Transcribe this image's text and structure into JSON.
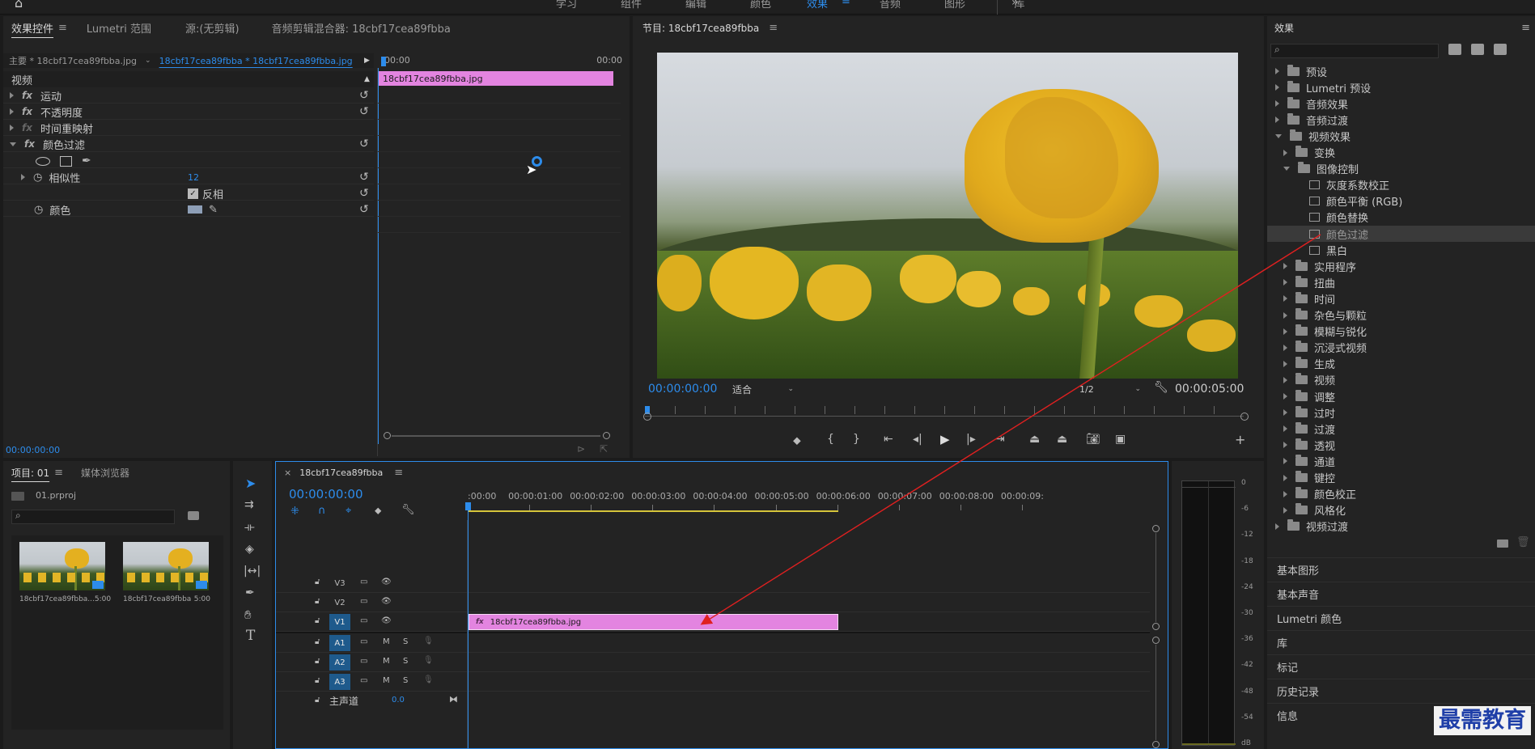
{
  "menu": {
    "items": [
      "学习",
      "组件",
      "编辑",
      "颜色",
      "效果",
      "音频",
      "图形",
      "库"
    ],
    "active": "效果",
    "overflow": "»"
  },
  "effect_controls": {
    "tabs": [
      "效果控件",
      "Lumetri 范围",
      "源:(无剪辑)",
      "音频剪辑混合器: 18cbf17cea89fbba"
    ],
    "master_label": "主要 * 18cbf17cea89fbba.jpg",
    "sequence_label": "18cbf17cea89fbba * 18cbf17cea89fbba.jpg",
    "time_start": "00:00",
    "time_end": "00:00",
    "section": "视频",
    "effects": [
      "运动",
      "不透明度",
      "时间重映射",
      "颜色过滤"
    ],
    "similarity_label": "相似性",
    "similarity_value": "12",
    "invert_label": "反相",
    "color_label": "颜色",
    "clip_label": "18cbf17cea89fbba.jpg",
    "timecode": "00:00:00:00"
  },
  "program_monitor": {
    "title": "节目: 18cbf17cea89fbba",
    "timecode": "00:00:00:00",
    "fit": "适合",
    "resolution": "1/2",
    "duration": "00:00:05:00"
  },
  "effects_panel": {
    "title": "效果",
    "tree": [
      {
        "label": "预设",
        "depth": 0,
        "icon": "folder-star",
        "state": "closed"
      },
      {
        "label": "Lumetri 预设",
        "depth": 0,
        "icon": "folder-star",
        "state": "closed"
      },
      {
        "label": "音频效果",
        "depth": 0,
        "icon": "folder",
        "state": "closed"
      },
      {
        "label": "音频过渡",
        "depth": 0,
        "icon": "folder",
        "state": "closed"
      },
      {
        "label": "视频效果",
        "depth": 0,
        "icon": "folder",
        "state": "open"
      },
      {
        "label": "变换",
        "depth": 1,
        "icon": "folder",
        "state": "closed"
      },
      {
        "label": "图像控制",
        "depth": 1,
        "icon": "folder",
        "state": "open"
      },
      {
        "label": "灰度系数校正",
        "depth": 2,
        "icon": "effect",
        "state": ""
      },
      {
        "label": "颜色平衡 (RGB)",
        "depth": 2,
        "icon": "effect",
        "state": ""
      },
      {
        "label": "颜色替换",
        "depth": 2,
        "icon": "effect",
        "state": ""
      },
      {
        "label": "颜色过滤",
        "depth": 2,
        "icon": "effect",
        "state": "selected"
      },
      {
        "label": "黑白",
        "depth": 2,
        "icon": "effect",
        "state": ""
      },
      {
        "label": "实用程序",
        "depth": 1,
        "icon": "folder",
        "state": "closed"
      },
      {
        "label": "扭曲",
        "depth": 1,
        "icon": "folder",
        "state": "closed"
      },
      {
        "label": "时间",
        "depth": 1,
        "icon": "folder",
        "state": "closed"
      },
      {
        "label": "杂色与颗粒",
        "depth": 1,
        "icon": "folder",
        "state": "closed"
      },
      {
        "label": "模糊与锐化",
        "depth": 1,
        "icon": "folder",
        "state": "closed"
      },
      {
        "label": "沉浸式视频",
        "depth": 1,
        "icon": "folder",
        "state": "closed"
      },
      {
        "label": "生成",
        "depth": 1,
        "icon": "folder",
        "state": "closed"
      },
      {
        "label": "视频",
        "depth": 1,
        "icon": "folder",
        "state": "closed"
      },
      {
        "label": "调整",
        "depth": 1,
        "icon": "folder",
        "state": "closed"
      },
      {
        "label": "过时",
        "depth": 1,
        "icon": "folder",
        "state": "closed"
      },
      {
        "label": "过渡",
        "depth": 1,
        "icon": "folder",
        "state": "closed"
      },
      {
        "label": "透视",
        "depth": 1,
        "icon": "folder",
        "state": "closed"
      },
      {
        "label": "通道",
        "depth": 1,
        "icon": "folder",
        "state": "closed"
      },
      {
        "label": "键控",
        "depth": 1,
        "icon": "folder",
        "state": "closed"
      },
      {
        "label": "颜色校正",
        "depth": 1,
        "icon": "folder",
        "state": "closed"
      },
      {
        "label": "风格化",
        "depth": 1,
        "icon": "folder",
        "state": "closed"
      },
      {
        "label": "视频过渡",
        "depth": 0,
        "icon": "folder",
        "state": "closed"
      }
    ],
    "collapsed_panels": [
      "基本图形",
      "基本声音",
      "Lumetri 颜色",
      "库",
      "标记",
      "历史记录",
      "信息"
    ]
  },
  "project_panel": {
    "tabs": [
      "项目: 01",
      "媒体浏览器"
    ],
    "project_file": "01.prproj",
    "items": [
      {
        "name": "18cbf17cea89fbba...",
        "duration": "5:00"
      },
      {
        "name": "18cbf17cea89fbba",
        "duration": "5:00"
      }
    ]
  },
  "timeline": {
    "title": "18cbf17cea89fbba",
    "timecode": "00:00:00:00",
    "ruler": [
      ":00:00",
      "00:00:01:00",
      "00:00:02:00",
      "00:00:03:00",
      "00:00:04:00",
      "00:00:05:00",
      "00:00:06:00",
      "00:00:07:00",
      "00:00:08:00",
      "00:00:09:"
    ],
    "video_tracks": [
      "V3",
      "V2",
      "V1"
    ],
    "audio_tracks": [
      "A1",
      "A2",
      "A3"
    ],
    "master_label": "主声道",
    "master_value": "0.0",
    "clip_label": "18cbf17cea89fbba.jpg",
    "track_buttons": {
      "mute": "M",
      "solo": "S"
    }
  },
  "audio_meter": {
    "labels": [
      "0",
      "-6",
      "-12",
      "-18",
      "-24",
      "-30",
      "-36",
      "-42",
      "-48",
      "-54",
      "dB"
    ]
  },
  "watermark": "最需教育",
  "colors": {
    "accent": "#2d8ceb",
    "clip": "#e384e0",
    "annotation": "#e02020",
    "panel_bg": "#232323"
  }
}
